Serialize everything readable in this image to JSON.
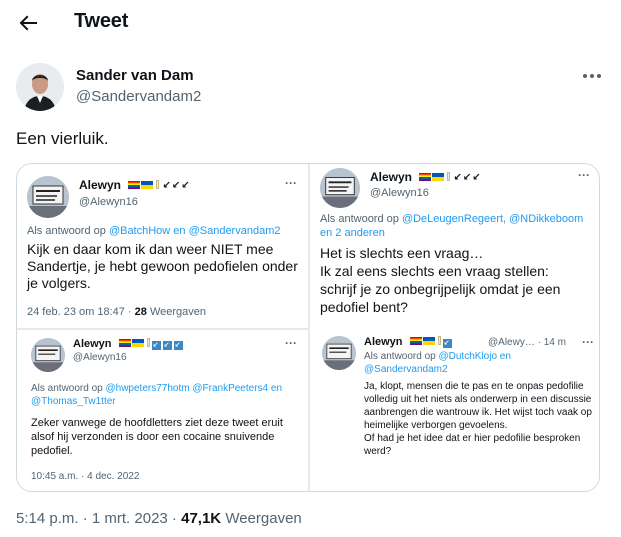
{
  "header": {
    "title": "Tweet"
  },
  "author": {
    "name": "Sander van Dam",
    "handle": "@Sandervandam2"
  },
  "tweet": {
    "text": "Een vierluik."
  },
  "screenshots": {
    "top_left": {
      "name": "Alewyn",
      "handle": "@Alewyn16",
      "reply_prefix": "Als antwoord op ",
      "reply_mentions": "@BatchHow en @Sandervandam2",
      "body": "Kijk en daar kom ik dan weer NIET mee Sandertje,  je hebt gewoon pedofielen onder je volgers.",
      "time": "24 feb. 23 om 18:47",
      "views_sep": " · ",
      "views_count": "28",
      "views_label": " Weergaven"
    },
    "top_right": {
      "name": "Alewyn",
      "handle": "@Alewyn16",
      "reply_prefix": "Als antwoord op ",
      "reply_mentions": "@DeLeugenRegeert, @NDikkeboom en 2 anderen",
      "body": "Het is slechts een vraag…\nIk zal eens slechts een vraag stellen:\nschrijf je zo onbegrijpelijk omdat je een pedofiel bent?"
    },
    "bottom_left": {
      "name": "Alewyn",
      "handle": "@Alewyn16",
      "reply_prefix": "Als antwoord op ",
      "reply_mentions": "@hwpeters77hotm @FrankPeeters4 en @Thomas_Tw1tter",
      "body": "Zeker vanwege de hoofdletters ziet deze tweet eruit alsof hij verzonden is door een cocaine snuivende pedofiel.",
      "time": "10:45 a.m. · 4 dec. 2022"
    },
    "bottom_right": {
      "name": "Alewyn",
      "handle": "@Alewy…",
      "time": "· 14 m",
      "reply_prefix": "Als antwoord op ",
      "reply_mentions": "@DutchKlojo en @Sandervandam2",
      "body": "Ja, klopt, mensen die te pas en te onpas pedofilie volledig uit het niets als onderwerp in een discussie aanbrengen die wantrouw ik. Het wijst toch vaak op heimelijke verborgen gevoelens.\nOf had je het idee dat er hier pedofilie besproken werd?"
    }
  },
  "footer": {
    "time": "5:14 p.m.",
    "date": "1 mrt. 2023",
    "views_count": "47,1K",
    "views_label": "Weergaven"
  },
  "colors": {
    "accent": "#1d9bf0",
    "muted": "#536471",
    "text": "#0f1419",
    "border": "#cfd9de"
  }
}
